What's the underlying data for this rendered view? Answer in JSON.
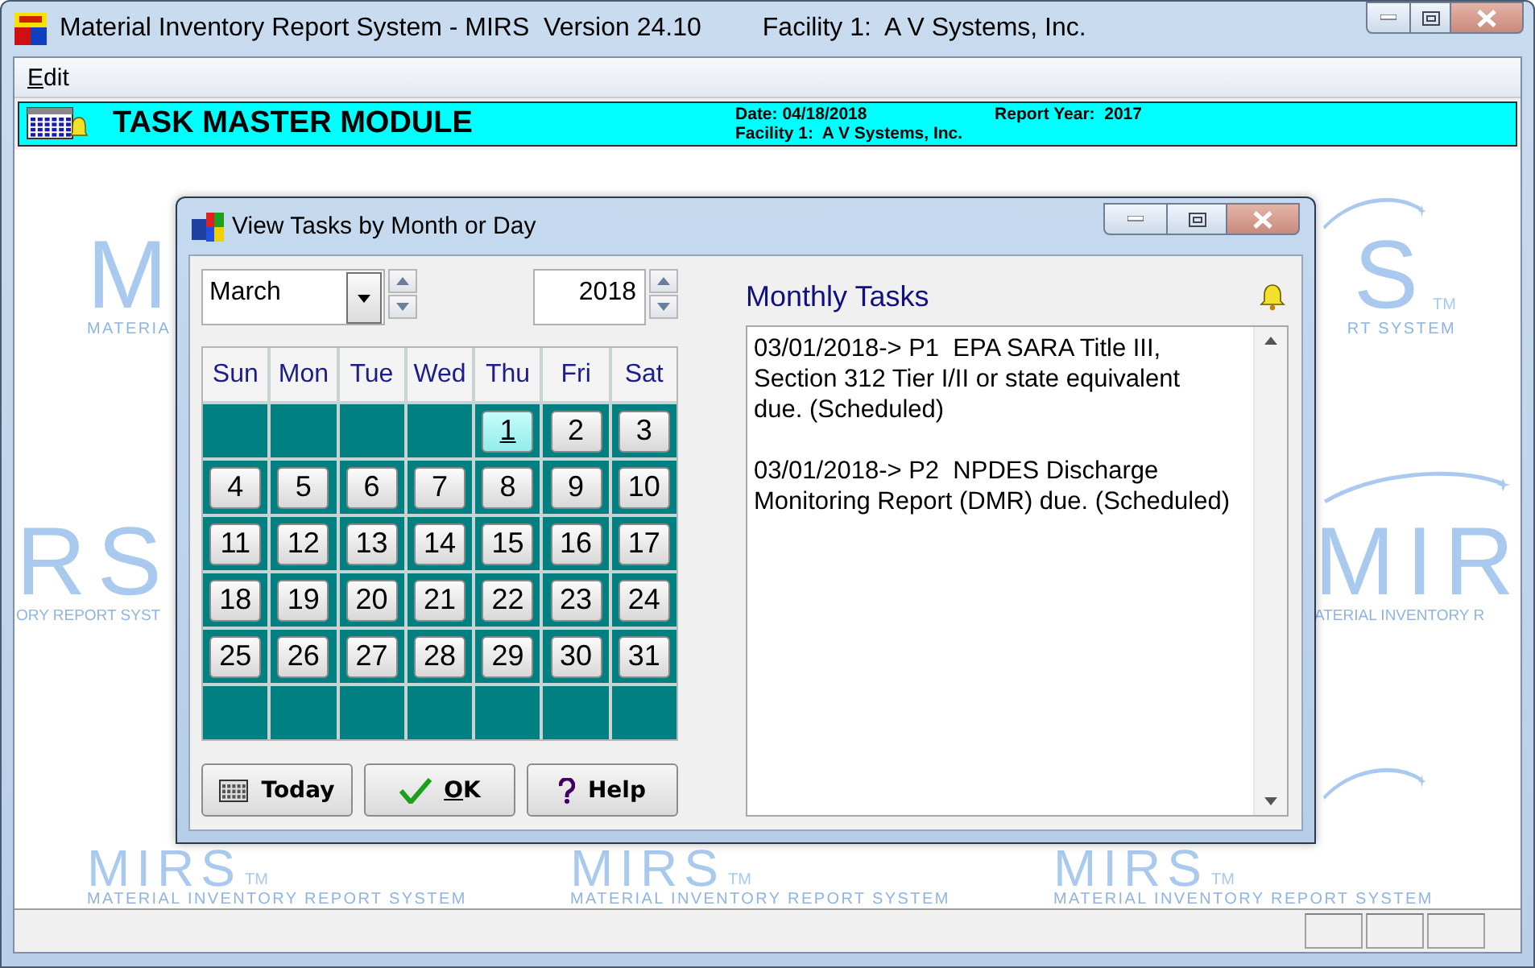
{
  "window": {
    "title": "Material Inventory Report System - MIRS  Version 24.10",
    "facility": "Facility 1:  A V Systems, Inc."
  },
  "menu": [
    {
      "label": "Edit",
      "mnemonic": true
    }
  ],
  "module_bar": {
    "title": "TASK MASTER MODULE",
    "date": "Date: 04/18/2018",
    "report_year": "Report Year:  2017",
    "facility": "Facility 1:  A V Systems, Inc."
  },
  "wallpaper": [
    {
      "mark": "M",
      "tagline": "MATERIA"
    },
    {
      "mark": "S",
      "tm": "TM",
      "tagline": "RT SYSTEM"
    },
    {
      "mark": "RS",
      "tagline": "ORY REPORT SYST"
    },
    {
      "mark": "MIR",
      "tagline": "ATERIAL INVENTORY R"
    },
    {
      "mark": "MIRS",
      "tm": "TM",
      "tagline": "MATERIAL INVENTORY REPORT SYSTEM"
    },
    {
      "mark": "MIRS",
      "tm": "TM",
      "tagline": "MATERIAL INVENTORY REPORT SYSTEM"
    },
    {
      "mark": "MIRS",
      "tm": "TM",
      "tagline": "MATERIAL INVENTORY REPORT SYSTEM"
    }
  ],
  "dialog": {
    "title": "View Tasks by Month or Day",
    "month": "March",
    "year": "2018",
    "weekdays": [
      "Sun",
      "Mon",
      "Tue",
      "Wed",
      "Thu",
      "Fri",
      "Sat"
    ],
    "weeks": [
      [
        {
          "kind": "blank"
        },
        {
          "kind": "blank"
        },
        {
          "kind": "blank"
        },
        {
          "kind": "blank"
        },
        {
          "label": "1",
          "selected": true
        },
        {
          "label": "2",
          "selected": false
        },
        {
          "label": "3",
          "selected": false
        }
      ],
      [
        {
          "label": "4",
          "selected": false
        },
        {
          "label": "5",
          "selected": false
        },
        {
          "label": "6",
          "selected": false
        },
        {
          "label": "7",
          "selected": false
        },
        {
          "label": "8",
          "selected": false
        },
        {
          "label": "9",
          "selected": false
        },
        {
          "label": "10",
          "selected": false
        }
      ],
      [
        {
          "label": "11",
          "selected": false
        },
        {
          "label": "12",
          "selected": false
        },
        {
          "label": "13",
          "selected": false
        },
        {
          "label": "14",
          "selected": false
        },
        {
          "label": "15",
          "selected": false
        },
        {
          "label": "16",
          "selected": false
        },
        {
          "label": "17",
          "selected": false
        }
      ],
      [
        {
          "label": "18",
          "selected": false
        },
        {
          "label": "19",
          "selected": false
        },
        {
          "label": "20",
          "selected": false
        },
        {
          "label": "21",
          "selected": false
        },
        {
          "label": "22",
          "selected": false
        },
        {
          "label": "23",
          "selected": false
        },
        {
          "label": "24",
          "selected": false
        }
      ],
      [
        {
          "label": "25",
          "selected": false
        },
        {
          "label": "26",
          "selected": false
        },
        {
          "label": "27",
          "selected": false
        },
        {
          "label": "28",
          "selected": false
        },
        {
          "label": "29",
          "selected": false
        },
        {
          "label": "30",
          "selected": false
        },
        {
          "label": "31",
          "selected": false
        }
      ],
      [
        {
          "kind": "blank"
        },
        {
          "kind": "blank"
        },
        {
          "kind": "blank"
        },
        {
          "kind": "blank"
        },
        {
          "kind": "blank"
        },
        {
          "kind": "blank"
        },
        {
          "kind": "blank"
        }
      ]
    ],
    "buttons": [
      {
        "kind": "today",
        "label": "Today",
        "mnemonic": false
      },
      {
        "kind": "ok",
        "label": "OK",
        "mnemonic": true
      },
      {
        "kind": "help",
        "label": "Help",
        "mnemonic": false
      }
    ],
    "tasks_panel": {
      "title": "Monthly Tasks",
      "entries": [
        "03/01/2018-> P1  EPA SARA Title III, Section 312 Tier I/II or state equivalent due. (Scheduled)",
        "03/01/2018-> P2  NPDES Discharge Monitoring Report (DMR) due. (Scheduled)"
      ]
    }
  }
}
